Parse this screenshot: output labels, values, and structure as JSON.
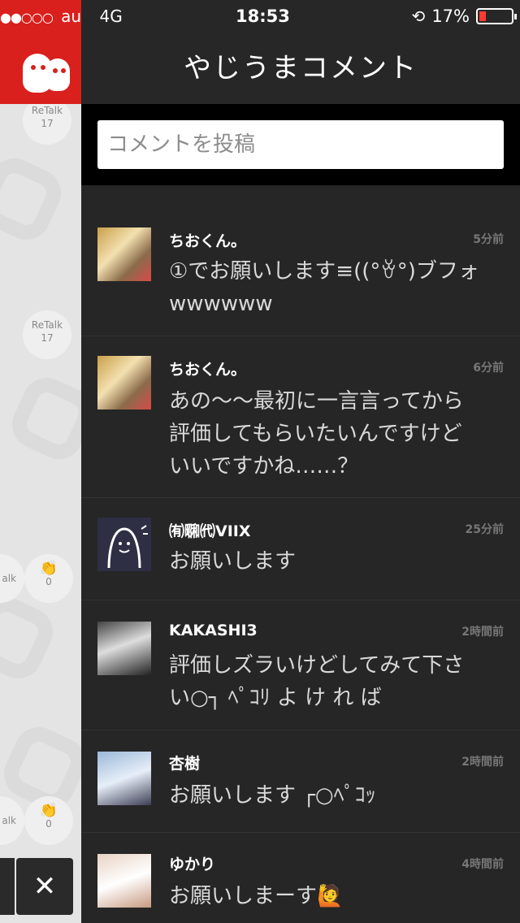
{
  "status": {
    "signal": "●●○○○",
    "carrier": "au",
    "network": "4G",
    "time": "18:53",
    "battery": "17%"
  },
  "header": {
    "title": "やじうまコメント"
  },
  "comment_input": {
    "placeholder": "コメントを投稿"
  },
  "side": {
    "retalk1_label": "ReTalk",
    "retalk1_count": "17",
    "retalk2_label": "ReTalk",
    "retalk2_count": "17",
    "talk1": "alk",
    "clap1_count": "0",
    "talk2": "alk",
    "clap2_count": "0",
    "close_glyph": "✕"
  },
  "comments": [
    {
      "name": "ちおくん。",
      "time": "5分前",
      "lines": [
        "①でお願いします≡((°ꈊ°)ブフォ",
        "wwwwww"
      ]
    },
    {
      "name": "ちおくん。",
      "time": "6分前",
      "lines": [
        "あの〜〜最初に一言言ってから",
        "評価してもらいたいんですけど",
        "いいですかね……？"
      ]
    },
    {
      "name": "㈲㍼㈹VIIX",
      "time": "25分前",
      "lines": [
        "お願いします"
      ]
    },
    {
      "name": "KAKASHI3",
      "time": "2時間前",
      "lines": [
        "評価しズラいけどしてみて下さ",
        "い○┐ ﾍﾟｺﾘ よ け れ ば"
      ]
    },
    {
      "name": "杏樹",
      "time": "2時間前",
      "lines": [
        "お願いします ┌○ﾍﾟｺｯ"
      ]
    },
    {
      "name": "ゆかり",
      "time": "4時間前",
      "lines": [
        "お願いしまーす🙋"
      ]
    }
  ],
  "colors": {
    "accent": "#d9201c",
    "header_bg": "#272727",
    "list_bg": "#262626"
  }
}
